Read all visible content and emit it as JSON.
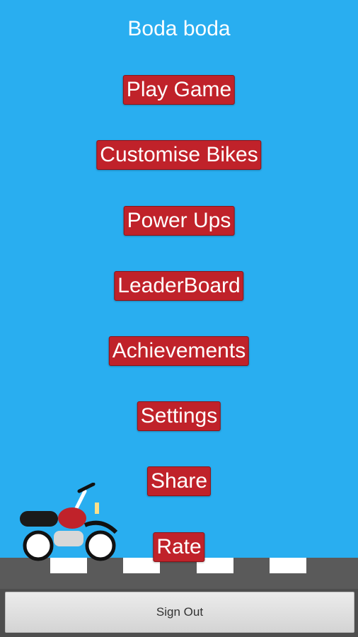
{
  "game": {
    "title": "Boda boda"
  },
  "menu": {
    "play_label": "Play Game",
    "customise_label": "Customise Bikes",
    "powerups_label": "Power Ups",
    "leaderboard_label": "LeaderBoard",
    "achievements_label": "Achievements",
    "settings_label": "Settings",
    "share_label": "Share",
    "rate_label": "Rate"
  },
  "auth": {
    "signout_label": "Sign Out"
  },
  "colors": {
    "sky": "#29aef0",
    "button": "#c0222a",
    "road": "#5a5a5a"
  },
  "icons": {
    "vehicle": "motorbike-icon"
  }
}
